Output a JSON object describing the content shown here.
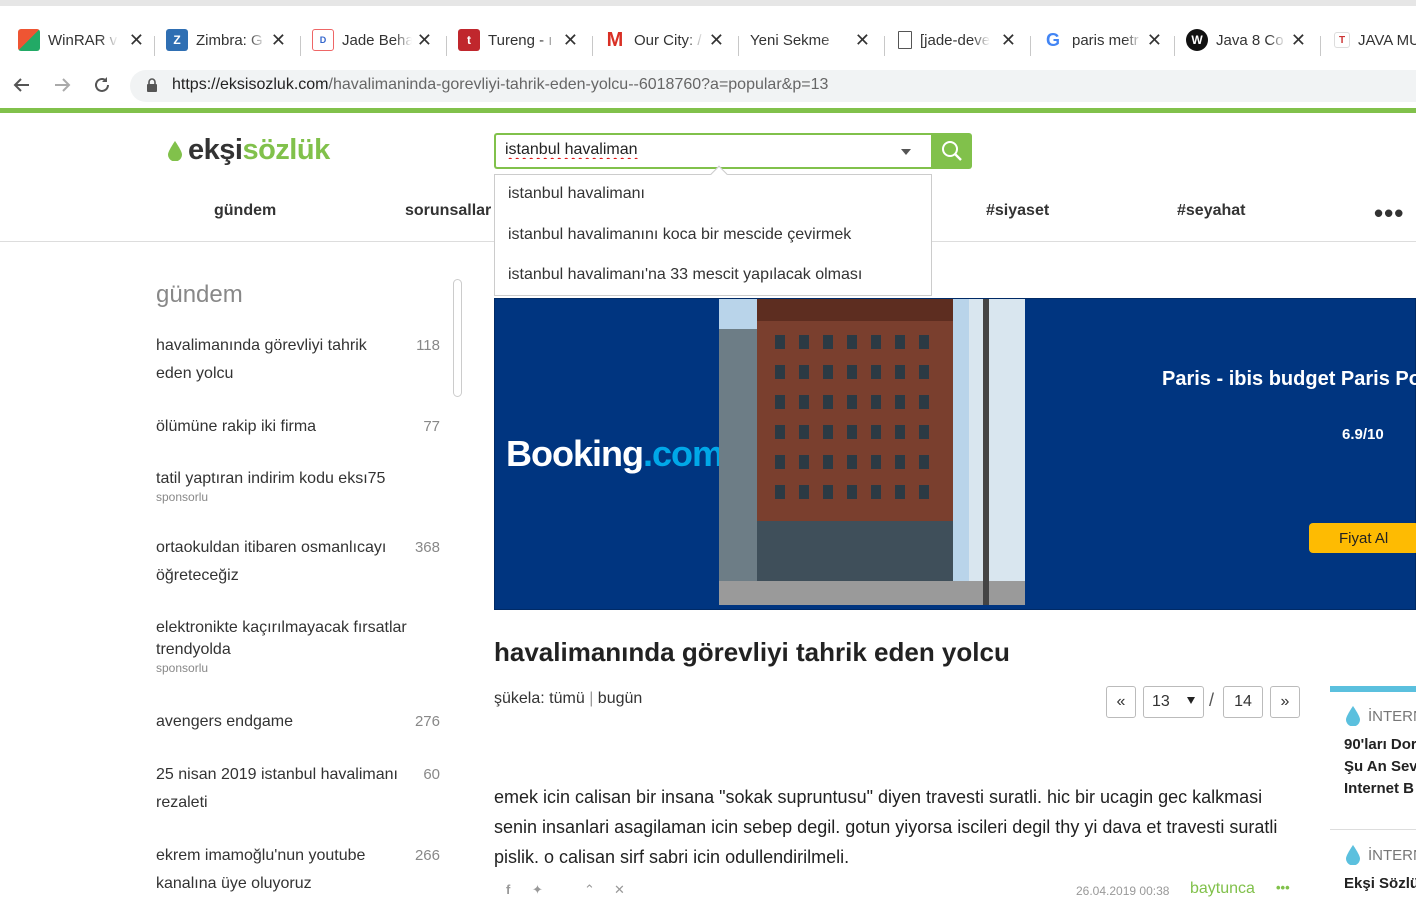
{
  "browser": {
    "tabs": [
      {
        "title": "WinRAR v",
        "icon": "winrar-icon"
      },
      {
        "title": "Zimbra: G",
        "icon": "zimbra-icon"
      },
      {
        "title": "Jade Beha",
        "icon": "diro-icon"
      },
      {
        "title": "Tureng - ı",
        "icon": "tureng-icon"
      },
      {
        "title": "Our City: /",
        "icon": "gmail-icon"
      },
      {
        "title": "Yeni Sekme",
        "icon": ""
      },
      {
        "title": "[jade-deve",
        "icon": "document-icon"
      },
      {
        "title": "paris metr",
        "icon": "google-icon"
      },
      {
        "title": "Java 8 Co",
        "icon": "wordpress-icon"
      },
      {
        "title": "JAVA MU",
        "icon": "t-icon"
      }
    ],
    "url_host": "https://eksisozluk.com",
    "url_path": "/havalimaninda-gorevliyi-tahrik-eden-yolcu--6018760?a=popular&p=13"
  },
  "site": {
    "logo_a": "ekşi",
    "logo_b": "sözlük",
    "search_value": "istanbul havaliman",
    "suggestions": [
      "istanbul havalimanı",
      "istanbul havalimanını koca bir mescide çevirmek",
      "istanbul havalimanı'na 33 mescit yapılacak olması"
    ],
    "nav": [
      "gündem",
      "sorunsallar",
      "#siyaset",
      "#seyahat"
    ]
  },
  "sidebar": {
    "heading": "gündem",
    "items": [
      {
        "title": "havalimanında görevliyi tahrik eden yolcu",
        "count": "118",
        "sponsored": ""
      },
      {
        "title": "ölümüne rakip iki firma",
        "count": "77",
        "sponsored": ""
      },
      {
        "title": "tatil yaptıran indirim kodu eksı75",
        "count": "",
        "sponsored": "sponsorlu"
      },
      {
        "title": "ortaokuldan itibaren osmanlıcayı öğreteceğiz",
        "count": "368",
        "sponsored": ""
      },
      {
        "title": "elektronikte kaçırılmayacak fırsatlar trendyolda",
        "count": "",
        "sponsored": "sponsorlu"
      },
      {
        "title": "avengers endgame",
        "count": "276",
        "sponsored": ""
      },
      {
        "title": "25 nisan 2019 istanbul havalimanı rezaleti",
        "count": "60",
        "sponsored": ""
      },
      {
        "title": "ekrem imamoğlu'nun youtube kanalına üye oluyoruz",
        "count": "266",
        "sponsored": ""
      }
    ]
  },
  "ad": {
    "brand": "Booking",
    "brand_suffix": ".com",
    "hotel": "Paris - ibis budget Paris Por",
    "score": "6.9/10",
    "cta": "Fiyat Al"
  },
  "topic": {
    "title": "havalimanında görevliyi tahrik eden yolcu",
    "sukela_label": "şükela:",
    "filter_all": "tümü",
    "filter_sep": "|",
    "filter_today": "bugün",
    "page_prev": "«",
    "page_current": "13",
    "page_sep": "/",
    "page_total": "14",
    "page_next": "»",
    "entry_text": "emek icin calisan bir insana \"sokak supruntusu\" diyen travesti suratli. hic bir ucagin gec kalkmasi senin insanlari asagilaman icin sebep degil. gotun yiyorsa iscileri degil thy yi dava et travesti suratli pislik. o calisan sirf sabri icin odullendirilmeli.",
    "entry_date": "26.04.2019 00:38",
    "entry_author": "baytunca"
  },
  "right_col": {
    "cat1": "İNTERN",
    "text1": [
      "90'ları Dor",
      "Şu An Sev",
      "Internet B"
    ],
    "cat2": "İNTERN",
    "text2": "Ekşi Sözlü"
  },
  "colors": {
    "accent": "#81c14b",
    "booking_blue": "#003580",
    "booking_yellow": "#febb02"
  }
}
